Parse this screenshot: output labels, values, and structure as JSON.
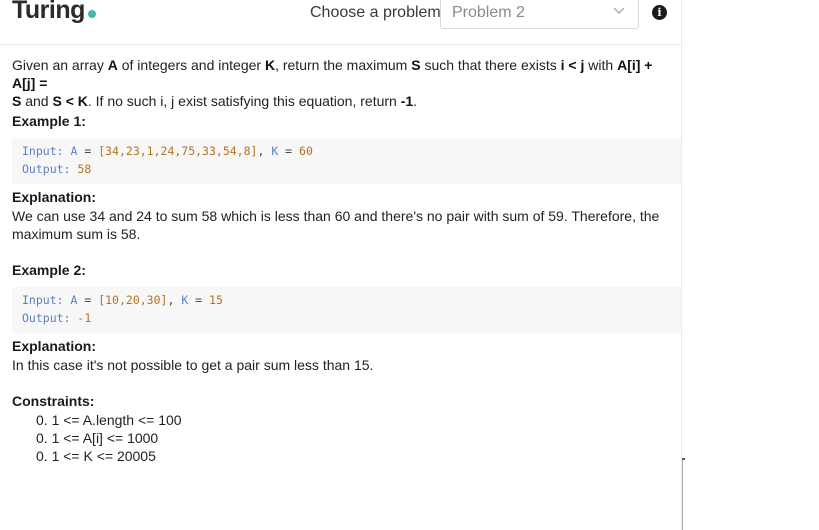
{
  "header": {
    "logo": "Turing",
    "choose_label": "Choose a problem",
    "problem_select": {
      "value": "Problem 2"
    },
    "info_icon": "i"
  },
  "problem": {
    "desc_1": "Given an array ",
    "desc_A": "A",
    "desc_2": " of integers and integer ",
    "desc_K": "K",
    "desc_3": ", return the maximum ",
    "desc_S": "S",
    "desc_4": " such that there exists ",
    "desc_ij": "i < j",
    "desc_5": " with ",
    "desc_eq": "A[i] + A[j] =",
    "desc_6": "S",
    "desc_7": " and ",
    "desc_SK": "S < K",
    "desc_8": ". If no such i, j exist satisfying this equation, return ",
    "desc_neg": "-1",
    "desc_9": "."
  },
  "examples": [
    {
      "title": "Example 1:",
      "input_label": "Input:",
      "input_A": "A",
      "input_eq": " = ",
      "input_array": "[34,23,1,24,75,33,54,8]",
      "input_comma": ", ",
      "input_K": "K",
      "input_eq2": " = ",
      "input_Kval": "60",
      "output_label": "Output:",
      "output_value": "58",
      "explanation_title": "Explanation:",
      "explanation": "We can use 34 and 24 to sum 58 which is less than 60 and there's no pair with sum of 59. Therefore, the maximum sum is 58."
    },
    {
      "title": "Example 2:",
      "input_label": "Input:",
      "input_A": "A",
      "input_eq": " = ",
      "input_array": "[10,20,30]",
      "input_comma": ", ",
      "input_K": "K",
      "input_eq2": " = ",
      "input_Kval": "15",
      "output_label": "Output:",
      "output_value": "-1",
      "explanation_title": "Explanation:",
      "explanation": "In this case it's not possible to get a pair sum less than 15."
    }
  ],
  "constraints": {
    "title": "Constraints:",
    "items": [
      "0. 1 <= A.length <= 100",
      "0. 1 <= A[i] <= 1000",
      "0. 1 <= K <= 20005"
    ]
  }
}
